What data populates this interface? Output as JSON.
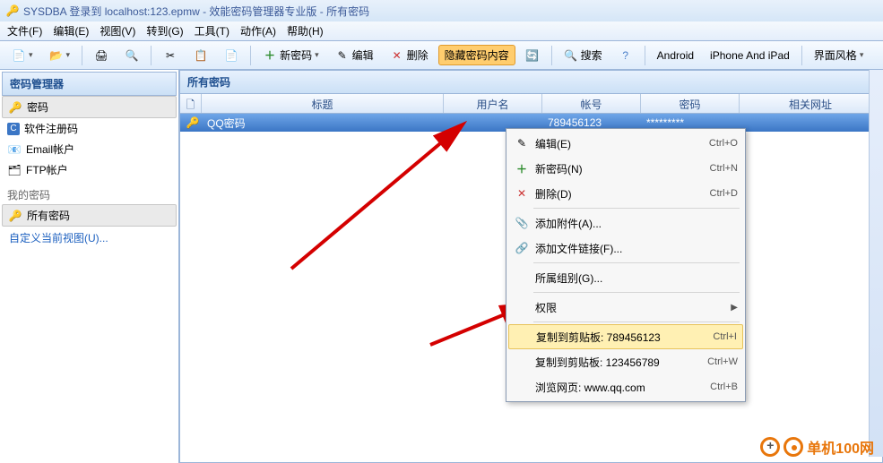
{
  "title": "SYSDBA 登录到 localhost:123.epmw - 效能密码管理器专业版 - 所有密码",
  "menu": [
    "文件(F)",
    "编辑(E)",
    "视图(V)",
    "转到(G)",
    "工具(T)",
    "动作(A)",
    "帮助(H)"
  ],
  "toolbar": {
    "new_password": "新密码",
    "edit": "编辑",
    "delete": "删除",
    "hide_content": "隐藏密码内容",
    "search": "搜索",
    "android": "Android",
    "iphone": "iPhone And iPad",
    "ui_style": "界面风格"
  },
  "sidebar": {
    "header": "密码管理器",
    "items": [
      {
        "label": "密码",
        "icon": "key"
      },
      {
        "label": "软件注册码",
        "icon": "cube"
      },
      {
        "label": "Email帐户",
        "icon": "mail"
      },
      {
        "label": "FTP帐户",
        "icon": "ftp"
      }
    ],
    "group2": "我的密码",
    "all_passwords": "所有密码",
    "custom_view": "自定义当前视图(U)..."
  },
  "content": {
    "header": "所有密码",
    "columns": [
      "标题",
      "用户名",
      "帐号",
      "密码",
      "相关网址"
    ],
    "row": {
      "title": "QQ密码",
      "user": "",
      "account": "789456123",
      "password": "*********",
      "url": ""
    }
  },
  "context": {
    "edit": {
      "label": "编辑(E)",
      "sc": "Ctrl+O"
    },
    "new": {
      "label": "新密码(N)",
      "sc": "Ctrl+N"
    },
    "delete": {
      "label": "删除(D)",
      "sc": "Ctrl+D"
    },
    "attach": {
      "label": "添加附件(A)..."
    },
    "link": {
      "label": "添加文件链接(F)..."
    },
    "group": {
      "label": "所属组别(G)..."
    },
    "perm": {
      "label": "权限"
    },
    "copy1": {
      "label": "复制到剪贴板: 789456123",
      "sc": "Ctrl+I"
    },
    "copy2": {
      "label": "复制到剪贴板: 123456789",
      "sc": "Ctrl+W"
    },
    "browse": {
      "label": "浏览网页: www.qq.com",
      "sc": "Ctrl+B"
    }
  },
  "watermark": "单机100网"
}
